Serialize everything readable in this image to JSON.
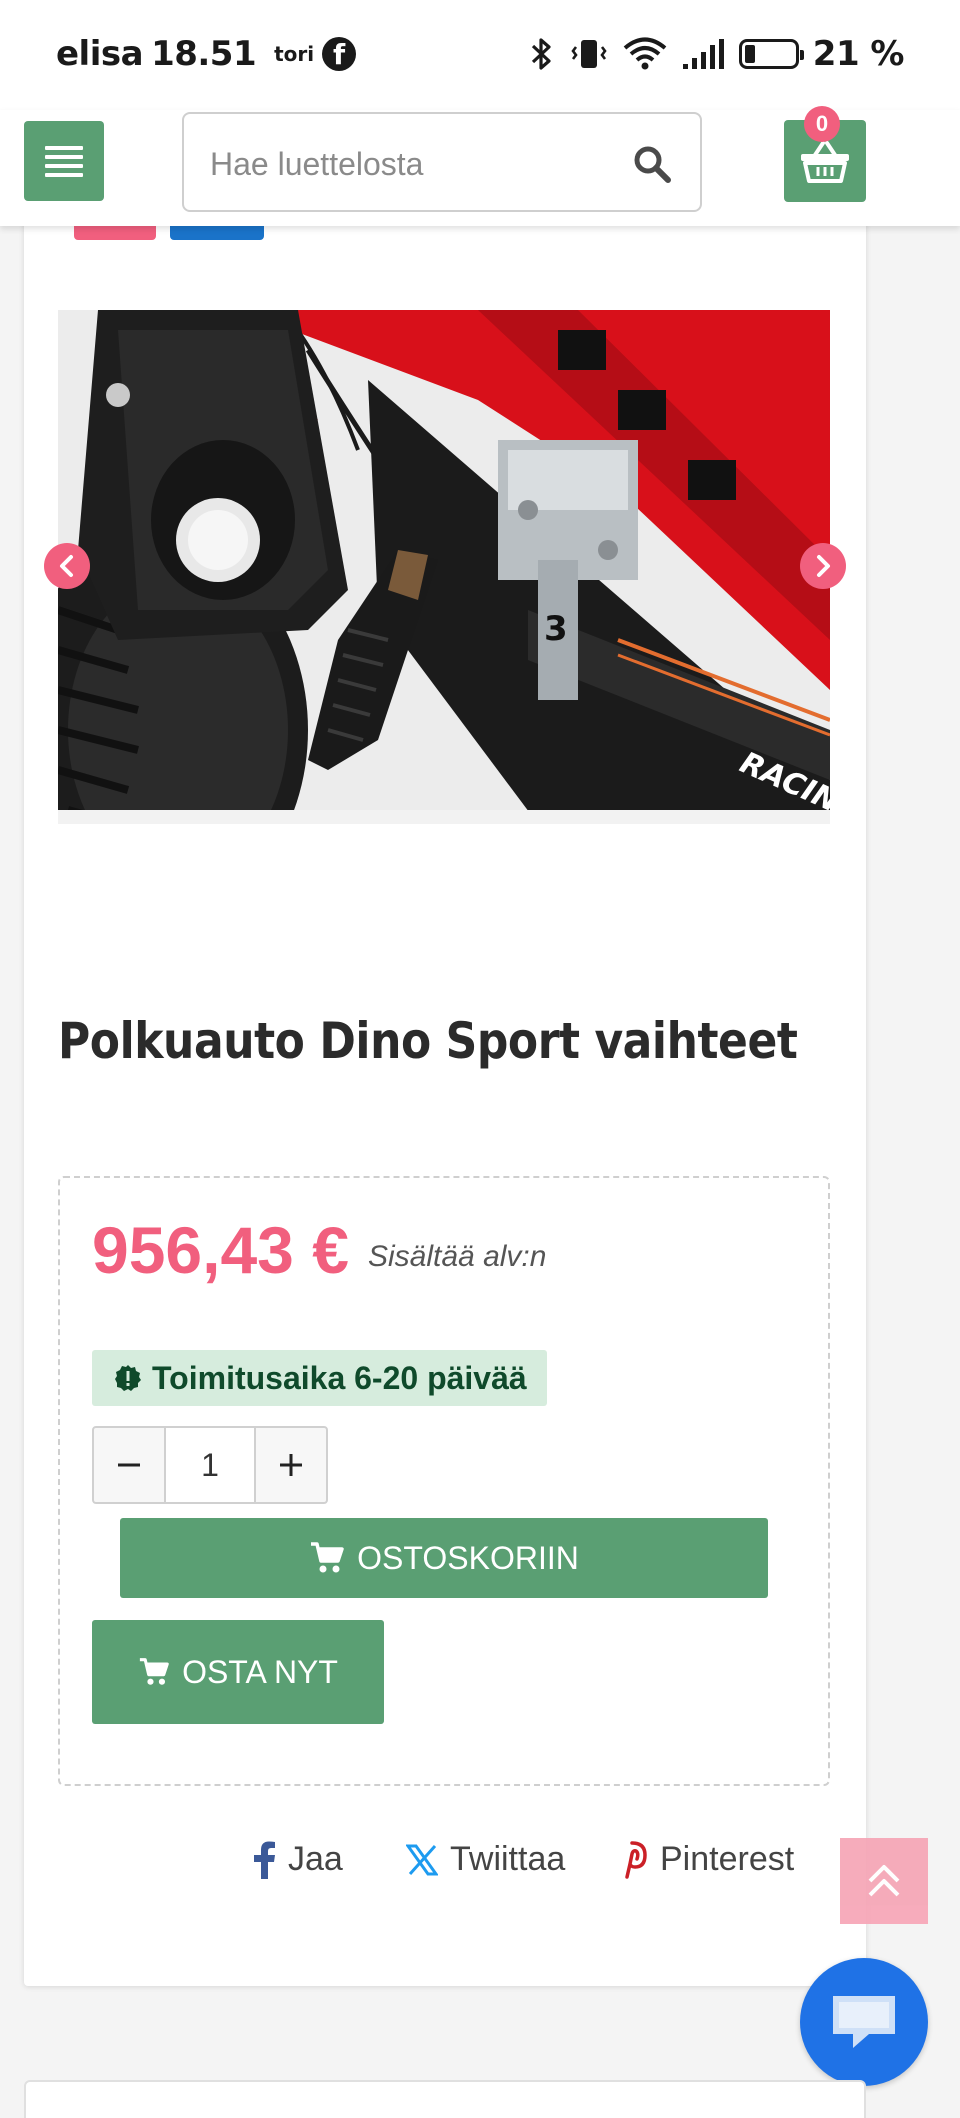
{
  "status_bar": {
    "carrier": "elisa",
    "time": "18.51",
    "app_label": "tori",
    "battery": "21 %",
    "battery_level": 0.21
  },
  "header": {
    "search_placeholder": "Hae luettelosta",
    "cart_count": "0"
  },
  "product": {
    "title": "Polkuauto Dino Sport vaihteet",
    "price": "956,43 €",
    "vat_note": "Sisältää alv:n",
    "delivery": "Toimitusaika 6-20 päivää",
    "quantity": "1",
    "add_to_cart": "OSTOSKORIIN",
    "buy_now": "OSTA NYT",
    "image_text": "RACIN",
    "image_number": "3"
  },
  "share": {
    "facebook": "Jaa",
    "twitter": "Twiittaa",
    "pinterest": "Pinterest"
  },
  "colors": {
    "accent_green": "#5a9f73",
    "accent_pink": "#f15f7e",
    "chat_blue": "#1f72e6"
  }
}
